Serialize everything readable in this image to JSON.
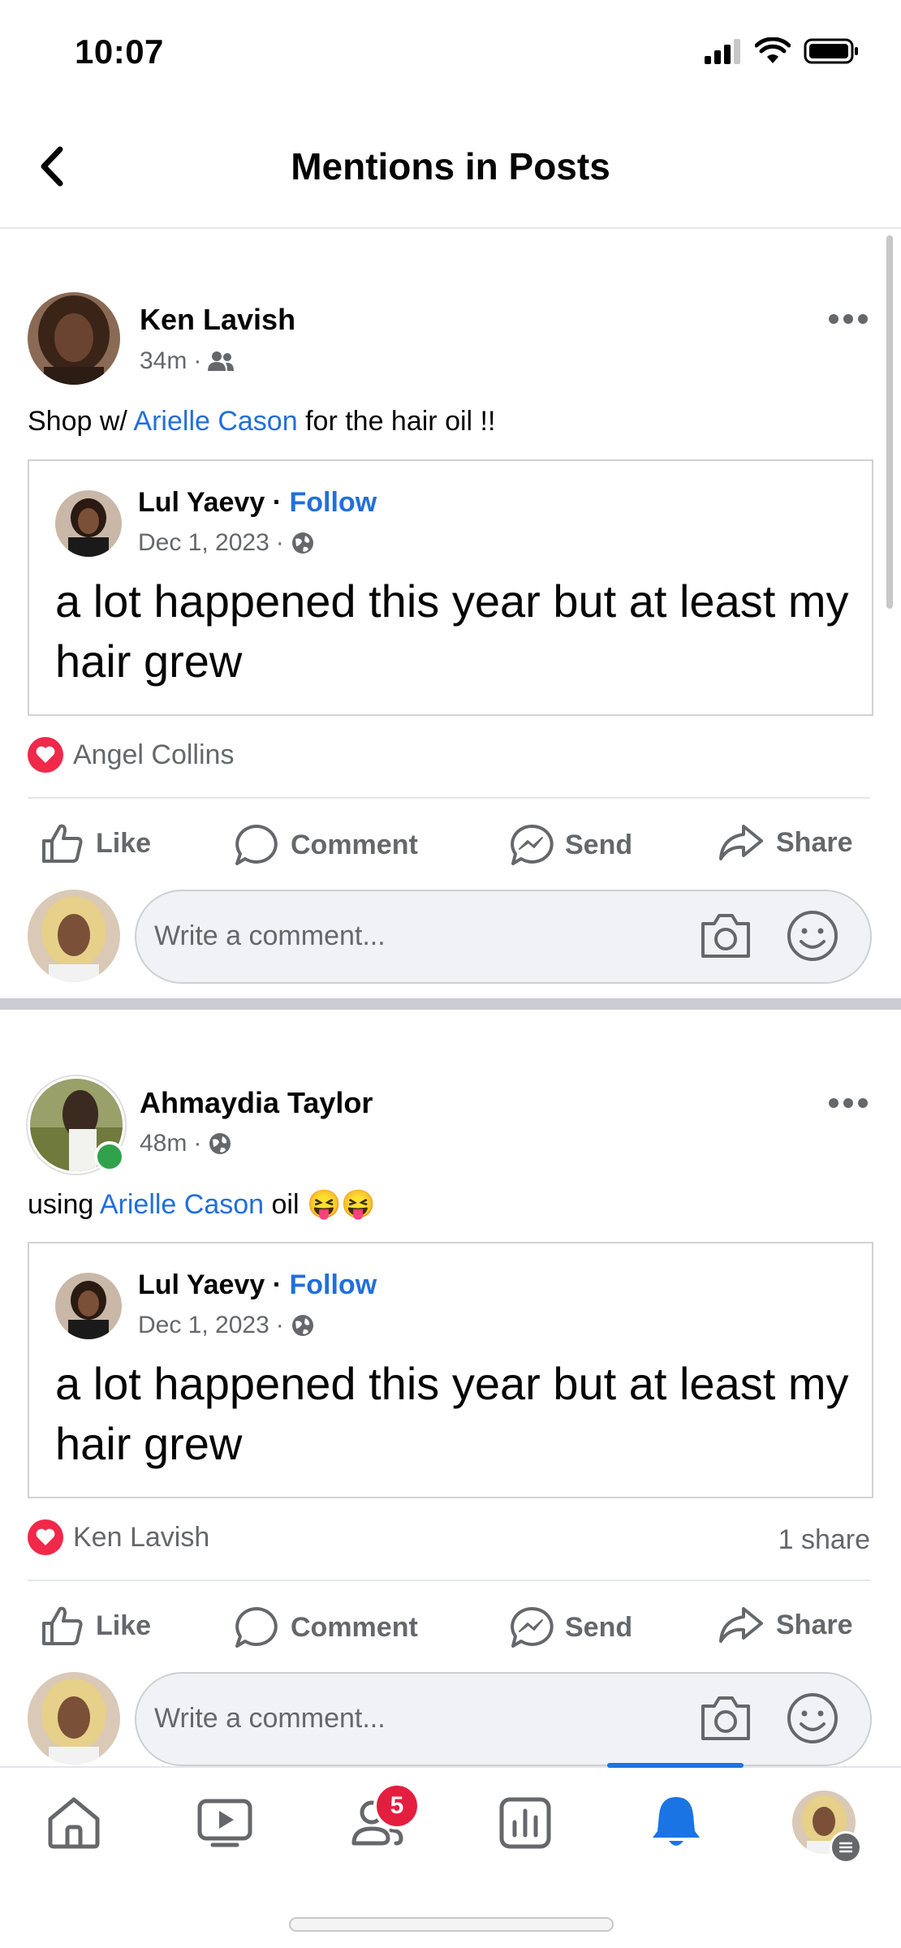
{
  "status_bar": {
    "time": "10:07"
  },
  "header": {
    "title": "Mentions in Posts"
  },
  "posts": [
    {
      "author": "Ken Lavish",
      "time": "34m",
      "audience_icon": "friends-icon",
      "text_before": "Shop w/ ",
      "mention": "Arielle Cason",
      "text_after": " for the hair oil !!",
      "shared": {
        "author": "Lul Yaevy",
        "follow_label": "Follow",
        "date": "Dec 1, 2023",
        "audience_icon": "globe-icon",
        "text": "a lot happened this year but at least my hair grew"
      },
      "reaction_name": "Angel Collins",
      "share_count": ""
    },
    {
      "author": "Ahmaydia Taylor",
      "time": "48m",
      "audience_icon": "globe-icon",
      "text_before": "using ",
      "mention": "Arielle Cason",
      "text_after": " oil 😝😝",
      "shared": {
        "author": "Lul Yaevy",
        "follow_label": "Follow",
        "date": "Dec 1, 2023",
        "audience_icon": "globe-icon",
        "text": "a lot happened this year but at least my hair grew"
      },
      "reaction_name": "Ken Lavish",
      "share_count": "1 share"
    }
  ],
  "actions": {
    "like": "Like",
    "comment": "Comment",
    "send": "Send",
    "share": "Share"
  },
  "comment_placeholder": "Write a comment...",
  "nav": {
    "items": [
      "home",
      "video",
      "friends",
      "dashboard",
      "notifications",
      "profile"
    ],
    "active": "notifications",
    "friends_badge": "5"
  },
  "colors": {
    "link": "#216fdb",
    "heart": "#f0284a",
    "nav_active": "#1b74e4",
    "badge": "#e41e3f"
  }
}
